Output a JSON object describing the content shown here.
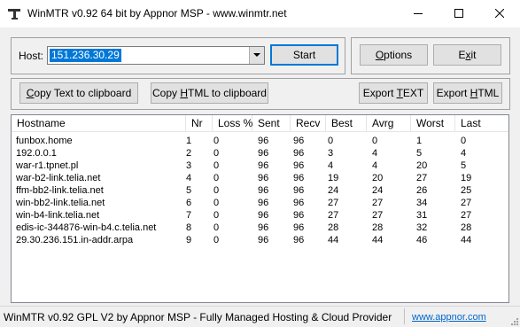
{
  "window": {
    "title": "WinMTR v0.92 64 bit by Appnor MSP - www.winmtr.net",
    "app_icon": "pickaxe-icon",
    "controls": [
      "minimize-icon",
      "maximize-icon",
      "close-icon"
    ]
  },
  "host_group": {
    "host_label": "Host:",
    "host_value": "151.236.30.29",
    "start_label": "Start"
  },
  "actions": {
    "options_label": "Options",
    "options_accel": "O",
    "options_rest": "ptions",
    "exit_label": "Exit",
    "exit_pre": "E",
    "exit_accel": "x",
    "exit_rest": "it"
  },
  "export": {
    "copy_text_label": "Copy Text to clipboard",
    "copy_text_accel": "C",
    "copy_text_rest": "opy Text to clipboard",
    "copy_html_label": "Copy HTML to clipboard",
    "copy_html_pre": "Copy ",
    "copy_html_accel": "H",
    "copy_html_rest": "TML to clipboard",
    "export_text_label": "Export TEXT",
    "export_text_pre": "Export ",
    "export_text_accel": "T",
    "export_text_rest": "EXT",
    "export_html_label": "Export HTML",
    "export_html_pre": "Export ",
    "export_html_accel": "H",
    "export_html_rest": "TML"
  },
  "table": {
    "columns": [
      "Hostname",
      "Nr",
      "Loss %",
      "Sent",
      "Recv",
      "Best",
      "Avrg",
      "Worst",
      "Last"
    ],
    "rows": [
      [
        "funbox.home",
        "1",
        "0",
        "96",
        "96",
        "0",
        "0",
        "1",
        "0"
      ],
      [
        "192.0.0.1",
        "2",
        "0",
        "96",
        "96",
        "3",
        "4",
        "5",
        "4"
      ],
      [
        "war-r1.tpnet.pl",
        "3",
        "0",
        "96",
        "96",
        "4",
        "4",
        "20",
        "5"
      ],
      [
        "war-b2-link.telia.net",
        "4",
        "0",
        "96",
        "96",
        "19",
        "20",
        "27",
        "19"
      ],
      [
        "ffm-bb2-link.telia.net",
        "5",
        "0",
        "96",
        "96",
        "24",
        "24",
        "26",
        "25"
      ],
      [
        "win-bb2-link.telia.net",
        "6",
        "0",
        "96",
        "96",
        "27",
        "27",
        "34",
        "27"
      ],
      [
        "win-b4-link.telia.net",
        "7",
        "0",
        "96",
        "96",
        "27",
        "27",
        "31",
        "27"
      ],
      [
        "edis-ic-344876-win-b4.c.telia.net",
        "8",
        "0",
        "96",
        "96",
        "28",
        "28",
        "32",
        "28"
      ],
      [
        "29.30.236.151.in-addr.arpa",
        "9",
        "0",
        "96",
        "96",
        "44",
        "44",
        "46",
        "44"
      ]
    ]
  },
  "status": {
    "text": "WinMTR v0.92 GPL V2 by Appnor MSP - Fully Managed Hosting & Cloud Provider",
    "link": "www.appnor.com"
  }
}
